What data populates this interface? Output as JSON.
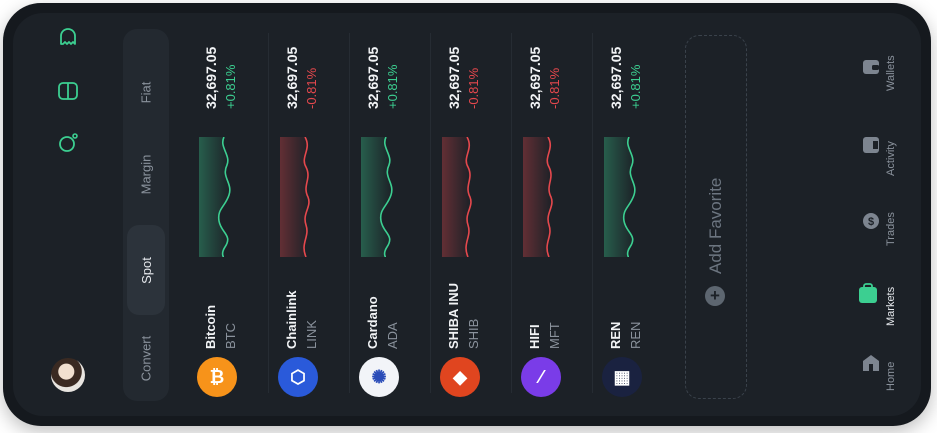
{
  "modes": [
    "Fiat",
    "Margin",
    "Spot",
    "Convert"
  ],
  "active_mode": "Spot",
  "coins": [
    {
      "name": "Bitcoin",
      "symbol": "BTC",
      "price": "32,697.05",
      "change": "+0.81%",
      "color": "#f7931a",
      "glyph": "₿",
      "trend": "up"
    },
    {
      "name": "Chainlink",
      "symbol": "LINK",
      "price": "32,697.05",
      "change": "-0.81%",
      "color": "#2a5ada",
      "glyph": "⬡",
      "trend": "down"
    },
    {
      "name": "Cardano",
      "symbol": "ADA",
      "price": "32,697.05",
      "change": "+0.81%",
      "color": "#f2f4f8",
      "glyph": "✺",
      "trend": "up"
    },
    {
      "name": "SHIBA INU",
      "symbol": "SHIB",
      "price": "32,697.05",
      "change": "-0.81%",
      "color": "#e0451f",
      "glyph": "◆",
      "trend": "down"
    },
    {
      "name": "HIFI",
      "symbol": "MFT",
      "price": "32,697.05",
      "change": "-0.81%",
      "color": "#7a3ce8",
      "glyph": "⁄",
      "trend": "down"
    },
    {
      "name": "REN",
      "symbol": "REN",
      "price": "32,697.05",
      "change": "+0.81%",
      "color": "#1a2240",
      "glyph": "▦",
      "trend": "up"
    }
  ],
  "add_favorite": "Add Favorite",
  "nav": [
    {
      "label": "Wallets",
      "icon": "wallet-icon"
    },
    {
      "label": "Activity",
      "icon": "activity-icon"
    },
    {
      "label": "Trades",
      "icon": "trades-icon"
    },
    {
      "label": "Markets",
      "icon": "markets-icon"
    },
    {
      "label": "Home",
      "icon": "home-icon"
    }
  ],
  "active_nav": "Markets",
  "colors": {
    "up": "#3ccf91",
    "down": "#e5484d",
    "accent": "#3ccf91"
  }
}
